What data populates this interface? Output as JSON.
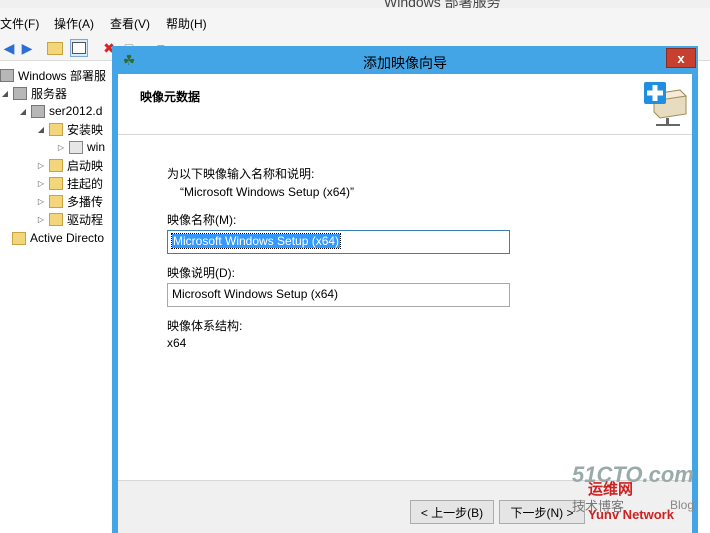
{
  "window": {
    "title": "Windows 部署服务"
  },
  "menu": [
    {
      "label": "文件(F)"
    },
    {
      "label": "操作(A)"
    },
    {
      "label": "查看(V)"
    },
    {
      "label": "帮助(H)"
    }
  ],
  "tree": [
    {
      "label": "Windows 部署服"
    },
    {
      "label": "服务器"
    },
    {
      "label": "ser2012.d"
    },
    {
      "label": "安装映"
    },
    {
      "label": "win"
    },
    {
      "label": "启动映"
    },
    {
      "label": "挂起的"
    },
    {
      "label": "多播传"
    },
    {
      "label": "驱动程"
    },
    {
      "label": "Active Directo"
    }
  ],
  "wizard": {
    "title": "添加映像向导",
    "close_label": "x",
    "header_title": "映像元数据",
    "instruction": "为以下映像输入名称和说明:",
    "source_image": "“Microsoft Windows Setup (x64)”",
    "name_label": "映像名称(M):",
    "name_value": "Microsoft Windows Setup (x64)",
    "desc_label": "映像说明(D):",
    "desc_value": "Microsoft Windows Setup (x64)",
    "arch_label": "映像体系结构:",
    "arch_value": "x64",
    "back_button": "< 上一步(B)",
    "next_button": "下一步(N) >"
  },
  "watermark": {
    "site": "51CTO.com",
    "cn": "运维网",
    "tech": "技术博客",
    "blog": "Blog",
    "brand": "Yunv Network"
  }
}
